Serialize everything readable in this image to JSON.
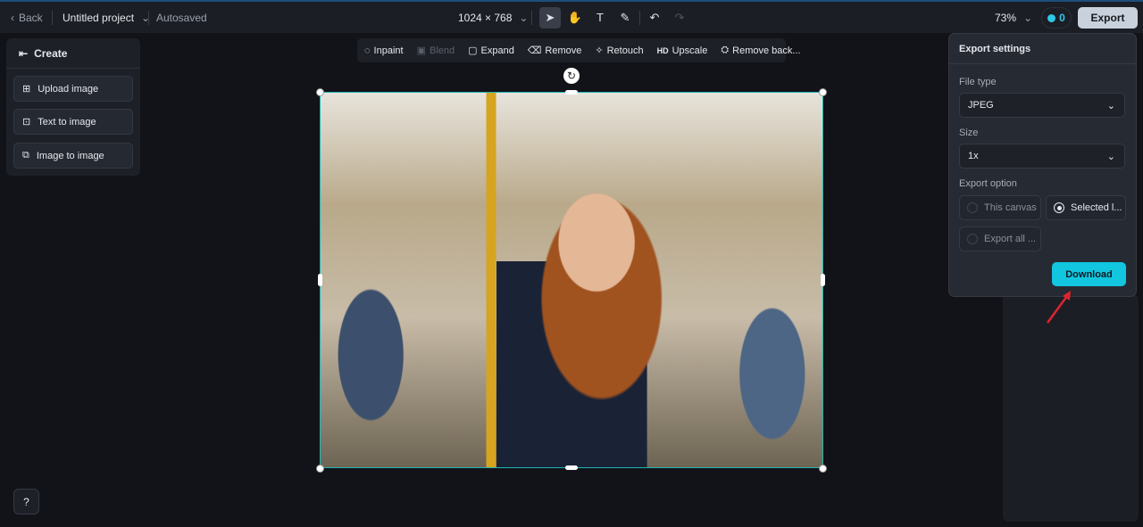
{
  "topbar": {
    "back": "Back",
    "project": "Untitled project",
    "autosave": "Autosaved",
    "dimensions": "1024 × 768",
    "zoom": "73%",
    "credits": "0",
    "export": "Export"
  },
  "create_panel": {
    "title": "Create",
    "items": [
      "Upload image",
      "Text to image",
      "Image to image"
    ]
  },
  "context_toolbar": {
    "items": [
      "Inpaint",
      "Blend",
      "Expand",
      "Remove",
      "Retouch",
      "Upscale",
      "Remove back..."
    ],
    "upscale_badge": "HD"
  },
  "export_settings": {
    "title": "Export settings",
    "file_type_label": "File type",
    "file_type": "JPEG",
    "size_label": "Size",
    "size": "1x",
    "export_option_label": "Export option",
    "options": [
      "This canvas",
      "Selected l...",
      "Export all ..."
    ],
    "selected_option": "Selected l...",
    "download": "Download"
  },
  "colors": {
    "accent": "#12c6e0",
    "selection": "#1fb6b6",
    "arrow": "#e0242c"
  }
}
